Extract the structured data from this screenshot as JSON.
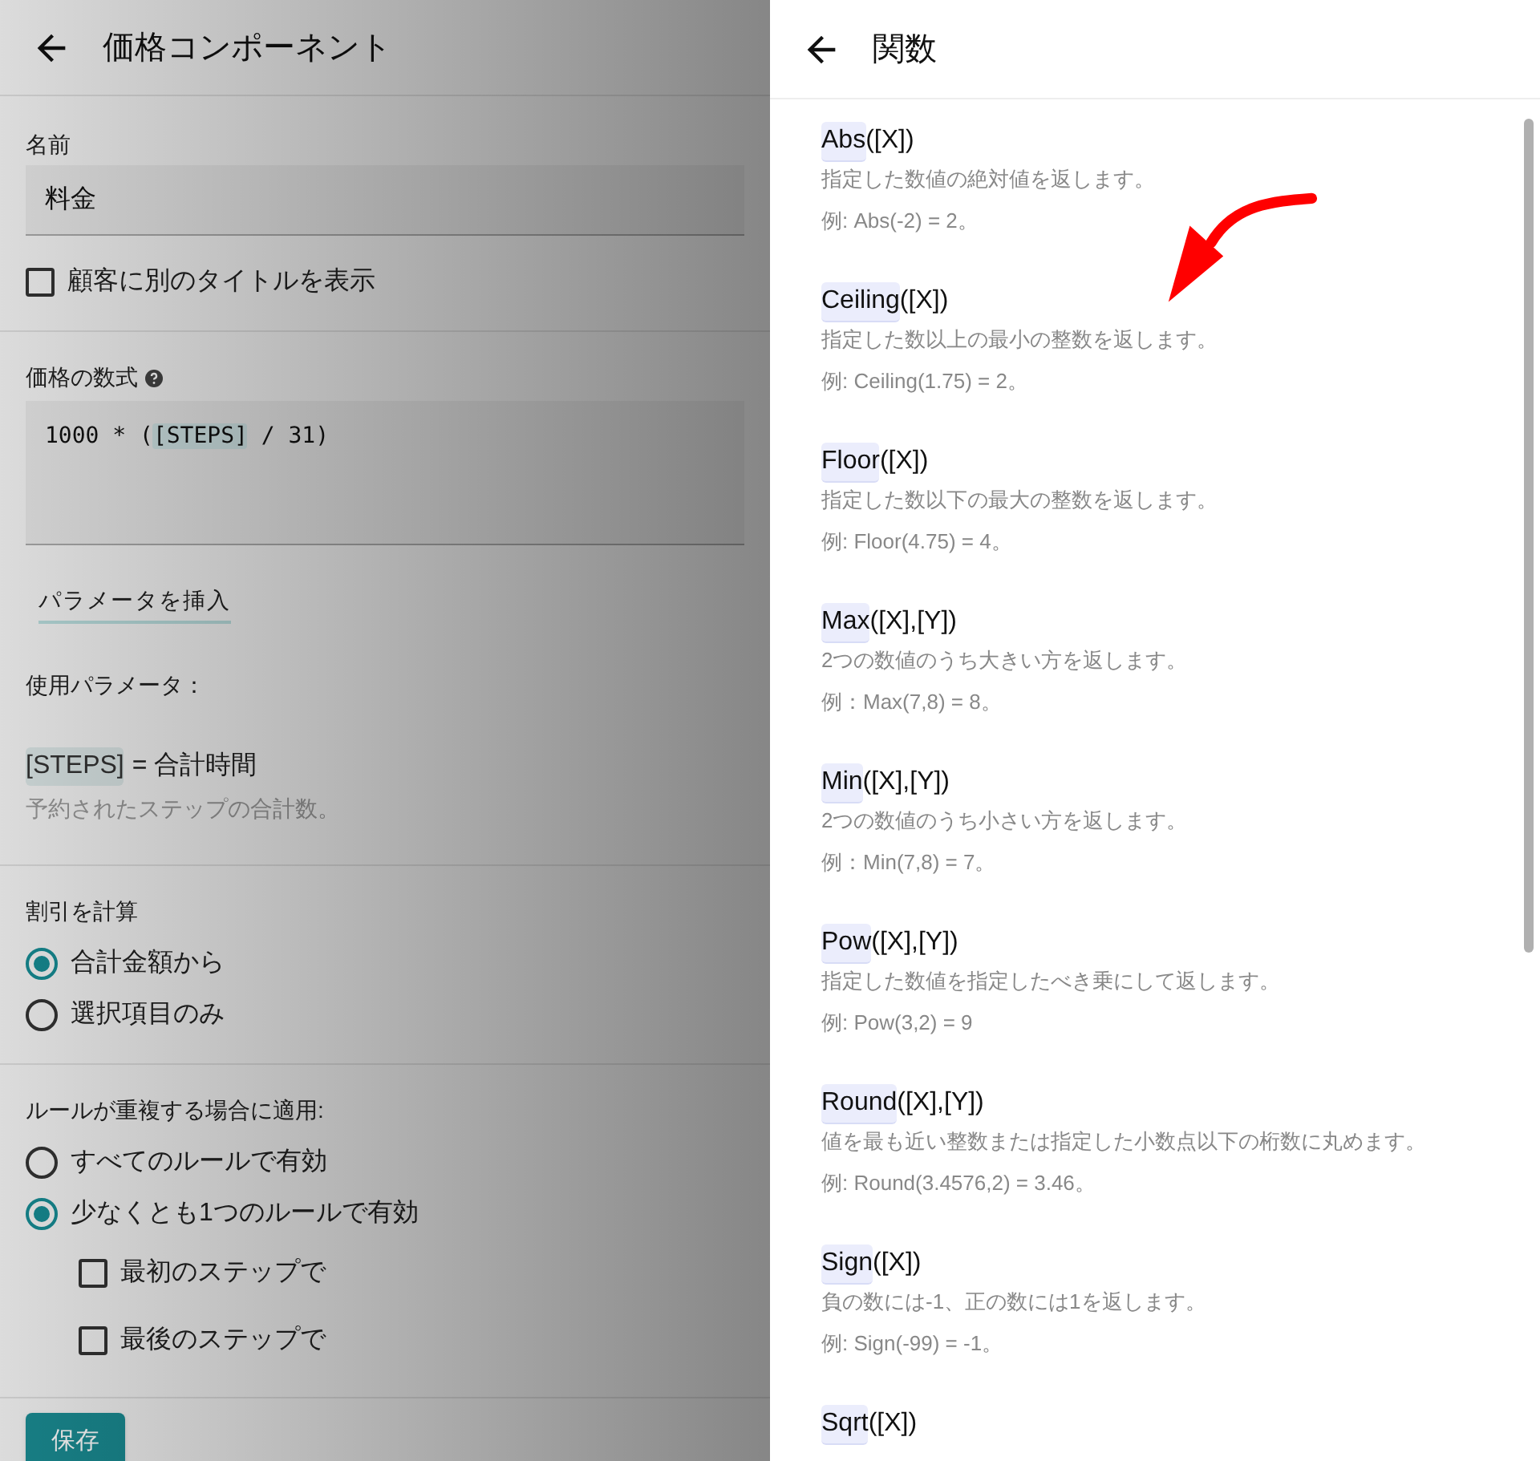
{
  "page": {
    "title": "価格コンポーネント",
    "name_field": {
      "label": "名前",
      "value": "料金"
    },
    "alt_title": {
      "label": "顧客に別のタイトルを表示",
      "checked": false
    },
    "formula": {
      "label": "価格の数式",
      "parts": [
        {
          "kind": "plain",
          "text": "1000 * ("
        },
        {
          "kind": "param",
          "text": "[STEPS]"
        },
        {
          "kind": "plain",
          "text": " / 31)"
        }
      ]
    },
    "insert_button": "パラメータを挿入",
    "params_label": "使用パラメータ：",
    "params": [
      {
        "token": "[STEPS]",
        "name": "= 合計時間",
        "description": "予約されたステップの合計数。"
      }
    ],
    "discount": {
      "label": "割引を計算",
      "options": [
        {
          "label": "合計金額から",
          "selected": true
        },
        {
          "label": "選択項目のみ",
          "selected": false
        }
      ]
    },
    "overlap": {
      "label": "ルールが重複する場合に適用:",
      "options": [
        {
          "label": "すべてのルールで有効",
          "selected": false
        },
        {
          "label": "少なくとも1つのルールで有効",
          "selected": true
        }
      ],
      "checks": [
        {
          "label": "最初のステップで",
          "checked": false
        },
        {
          "label": "最後のステップで",
          "checked": false
        }
      ]
    },
    "save_button": "保存"
  },
  "drawer": {
    "title": "関数",
    "functions": [
      {
        "name": "Abs",
        "args": "([X])",
        "description": "指定した数値の絶対値を返します。",
        "example": "例: Abs(-2) = 2。"
      },
      {
        "name": "Ceiling",
        "args": "([X])",
        "description": "指定した数以上の最小の整数を返します。",
        "example": "例: Ceiling(1.75) = 2。"
      },
      {
        "name": "Floor",
        "args": "([X])",
        "description": "指定した数以下の最大の整数を返します。",
        "example": "例: Floor(4.75) = 4。"
      },
      {
        "name": "Max",
        "args": "([X],[Y])",
        "description": "2つの数値のうち大きい方を返します。",
        "example": "例：Max(7,8) = 8。"
      },
      {
        "name": "Min",
        "args": "([X],[Y])",
        "description": "2つの数値のうち小さい方を返します。",
        "example": "例：Min(7,8) = 7。"
      },
      {
        "name": "Pow",
        "args": "([X],[Y])",
        "description": "指定した数値を指定したべき乗にして返します。",
        "example": "例: Pow(3,2) = 9"
      },
      {
        "name": "Round",
        "args": "([X],[Y])",
        "description": "値を最も近い整数または指定した小数点以下の桁数に丸めます。",
        "example": "例: Round(3.4576,2) = 3.46。"
      },
      {
        "name": "Sign",
        "args": "([X])",
        "description": "負の数には-1、正の数には1を返します。",
        "example": "例: Sign(-99) = -1。"
      },
      {
        "name": "Sqrt",
        "args": "([X])"
      }
    ]
  }
}
